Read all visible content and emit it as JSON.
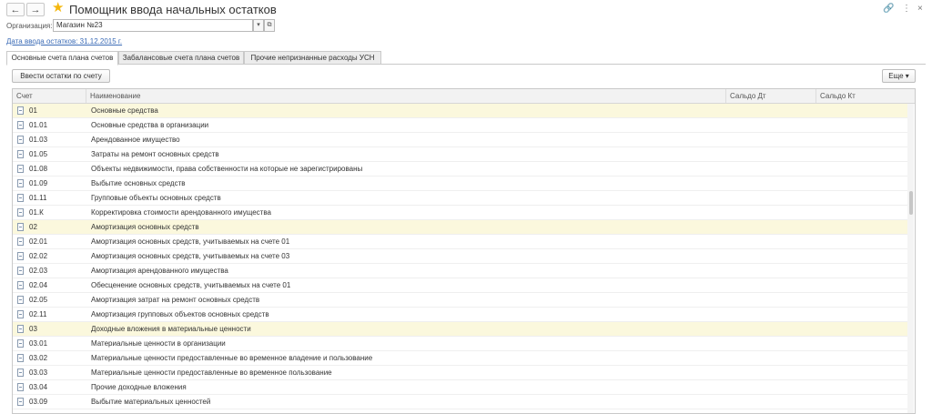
{
  "window": {
    "title": "Помощник ввода начальных остатков",
    "back_icon": "←",
    "forward_icon": "→",
    "star_icon": "★",
    "link_icon": "🔗",
    "more_icon": "⋮",
    "close_icon": "×"
  },
  "organization": {
    "label": "Организация:",
    "value": "Магазин №23",
    "dropdown_icon": "▾",
    "open_icon": "⧉"
  },
  "date_link": "Дата ввода остатков: 31.12.2015 г.",
  "tabs": [
    {
      "label": "Основные счета плана счетов",
      "active": true
    },
    {
      "label": "Забалансовые счета плана счетов",
      "active": false
    },
    {
      "label": "Прочие непризнанные расходы УСН",
      "active": false
    }
  ],
  "toolbar": {
    "enter_balances_label": "Ввести остатки по счету",
    "more_label": "Еще ▾"
  },
  "table": {
    "columns": [
      "Счет",
      "Наименование",
      "Сальдо Дт",
      "Сальдо Кт"
    ],
    "rows": [
      {
        "code": "01",
        "name": "Основные средства",
        "group": true
      },
      {
        "code": "01.01",
        "name": "Основные средства в организации",
        "group": false
      },
      {
        "code": "01.03",
        "name": "Арендованное имущество",
        "group": false
      },
      {
        "code": "01.05",
        "name": "Затраты на ремонт основных средств",
        "group": false
      },
      {
        "code": "01.08",
        "name": "Объекты недвижимости, права собственности на которые не зарегистрированы",
        "group": false
      },
      {
        "code": "01.09",
        "name": "Выбытие основных средств",
        "group": false
      },
      {
        "code": "01.11",
        "name": "Групповые объекты основных средств",
        "group": false
      },
      {
        "code": "01.К",
        "name": "Корректировка стоимости арендованного имущества",
        "group": false
      },
      {
        "code": "02",
        "name": "Амортизация основных средств",
        "group": true
      },
      {
        "code": "02.01",
        "name": "Амортизация основных средств, учитываемых на счете 01",
        "group": false
      },
      {
        "code": "02.02",
        "name": "Амортизация основных средств, учитываемых на счете 03",
        "group": false
      },
      {
        "code": "02.03",
        "name": "Амортизация арендованного имущества",
        "group": false
      },
      {
        "code": "02.04",
        "name": "Обесценение основных средств, учитываемых на счете 01",
        "group": false
      },
      {
        "code": "02.05",
        "name": "Амортизация затрат на ремонт основных средств",
        "group": false
      },
      {
        "code": "02.11",
        "name": "Амортизация групповых объектов основных средств",
        "group": false
      },
      {
        "code": "03",
        "name": "Доходные вложения в материальные ценности",
        "group": true
      },
      {
        "code": "03.01",
        "name": "Материальные ценности в организации",
        "group": false
      },
      {
        "code": "03.02",
        "name": "Материальные ценности предоставленные во временное владение и пользование",
        "group": false
      },
      {
        "code": "03.03",
        "name": "Материальные ценности предоставленные во временное пользование",
        "group": false
      },
      {
        "code": "03.04",
        "name": "Прочие доходные вложения",
        "group": false
      },
      {
        "code": "03.09",
        "name": "Выбытие материальных ценностей",
        "group": false
      }
    ]
  },
  "colors": {
    "highlight_row": "#fbf8dd",
    "link": "#3b6bb6",
    "star": "#f5b70d"
  }
}
